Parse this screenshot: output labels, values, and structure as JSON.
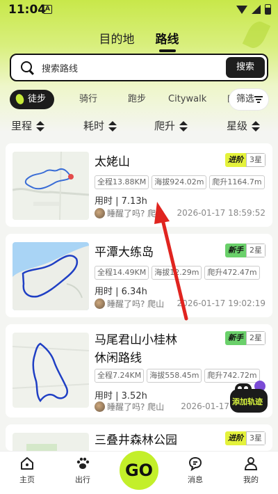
{
  "status_bar": {
    "time": "11:04",
    "app_indicator": "A"
  },
  "top_tabs": [
    {
      "label": "目的地",
      "active": false
    },
    {
      "label": "路线",
      "active": true
    }
  ],
  "search": {
    "placeholder": "搜索路线",
    "button": "搜索"
  },
  "categories": [
    {
      "label": "徒步",
      "active": true
    },
    {
      "label": "骑行",
      "active": false
    },
    {
      "label": "跑步",
      "active": false
    },
    {
      "label": "Citywalk",
      "active": false
    },
    {
      "label": "自",
      "active": false
    }
  ],
  "filter": {
    "label": "筛选",
    "icon": "filter-icon"
  },
  "sorts": [
    "里程",
    "耗时",
    "爬升",
    "星级"
  ],
  "routes": [
    {
      "title": "太姥山",
      "level": "进阶",
      "stars": "3星",
      "distance": "全程13.88KM",
      "altitude": "海拔924.02m",
      "climb": "爬升1164.7m",
      "duration": "用时 | 7.13h",
      "author": "睡醒了吗? 爬山",
      "date": "2026-01-17 18:59:52"
    },
    {
      "title": "平潭大练岛",
      "level": "新手",
      "stars": "2星",
      "distance": "全程14.49KM",
      "altitude": "海拔12.29m",
      "climb": "爬升472.47m",
      "duration": "用时 | 6.34h",
      "author": "睡醒了吗? 爬山",
      "date": "2026-01-17 19:02:19"
    },
    {
      "title_line1": "马尾君山小桂林",
      "title_line2": "休闲路线",
      "level": "新手",
      "stars": "2星",
      "distance": "全程7.24KM",
      "altitude": "海拔558.45m",
      "climb": "爬升742.72m",
      "duration": "用时 | 3.52h",
      "author": "睡醒了吗? 爬山",
      "date": "2026-01-17"
    },
    {
      "title": "三叠井森林公园",
      "level": "进阶",
      "stars": "3星"
    }
  ],
  "add_track": {
    "label": "添加轨迹"
  },
  "bottom_nav": [
    {
      "label": "主页",
      "icon": "home-icon"
    },
    {
      "label": "出行",
      "icon": "paw-icon"
    },
    {
      "label": "GO",
      "icon": "go-button"
    },
    {
      "label": "消息",
      "icon": "message-icon"
    },
    {
      "label": "我的",
      "icon": "profile-icon"
    }
  ]
}
